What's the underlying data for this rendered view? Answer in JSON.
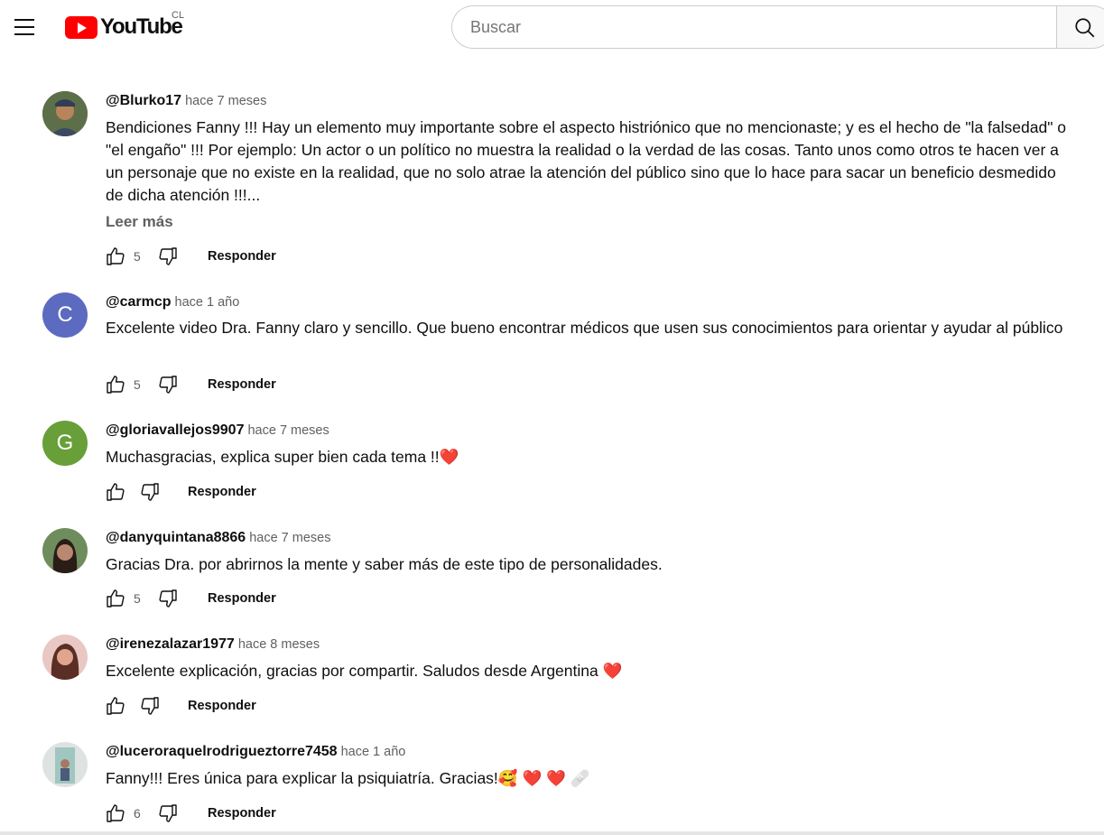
{
  "header": {
    "logo_text": "YouTube",
    "country": "CL",
    "search_placeholder": "Buscar"
  },
  "prev_reply_label": "Responder",
  "comments": [
    {
      "author": "@Blurko17",
      "time": "hace 7 meses",
      "text": "Bendiciones Fanny !!!  Hay un elemento muy importante sobre el aspecto histriónico que no mencionaste; y es el hecho de \"la falsedad\" o \"el engaño\" !!!  Por ejemplo:  Un actor o un político no muestra la realidad o la verdad de las cosas.  Tanto unos como otros te hacen ver a un personaje que no existe en la realidad, que no solo atrae la atención del público sino que lo hace para sacar un beneficio desmedido de dicha atención !!!...",
      "more": "Leer más",
      "likes": "5",
      "reply": "Responder"
    },
    {
      "author": "@carmcp",
      "time": "hace 1 año",
      "initial": "C",
      "text": "Excelente video Dra. Fanny  claro y sencillo. Que bueno encontrar médicos que usen sus conocimientos para orientar y ayudar al público",
      "likes": "5",
      "reply": "Responder"
    },
    {
      "author": "@gloriavallejos9907",
      "time": "hace 7 meses",
      "initial": "G",
      "text": "Muchasgracias, explica super bien cada tema !!",
      "emoji": "❤️",
      "likes": "",
      "reply": "Responder"
    },
    {
      "author": "@danyquintana8866",
      "time": "hace 7 meses",
      "text": "Gracias Dra. por abrirnos la mente y saber más de este tipo de personalidades.",
      "likes": "5",
      "reply": "Responder"
    },
    {
      "author": "@irenezalazar1977",
      "time": "hace 8 meses",
      "text": "Excelente explicación, gracias por compartir. Saludos desde Argentina ",
      "emoji": "❤️",
      "likes": "",
      "reply": "Responder"
    },
    {
      "author": "@luceroraquelrodrigueztorre7458",
      "time": "hace 1 año",
      "text": "Fanny!!! Eres única para explicar la psiquiatría. Gracias!",
      "emoji": "🥰 ❤️ ❤️ 🩹",
      "likes": "6",
      "reply": "Responder"
    }
  ],
  "colors": {
    "brand_red": "#ff0000",
    "avatar_c": "#5c6bc0",
    "avatar_g": "#689f38"
  }
}
